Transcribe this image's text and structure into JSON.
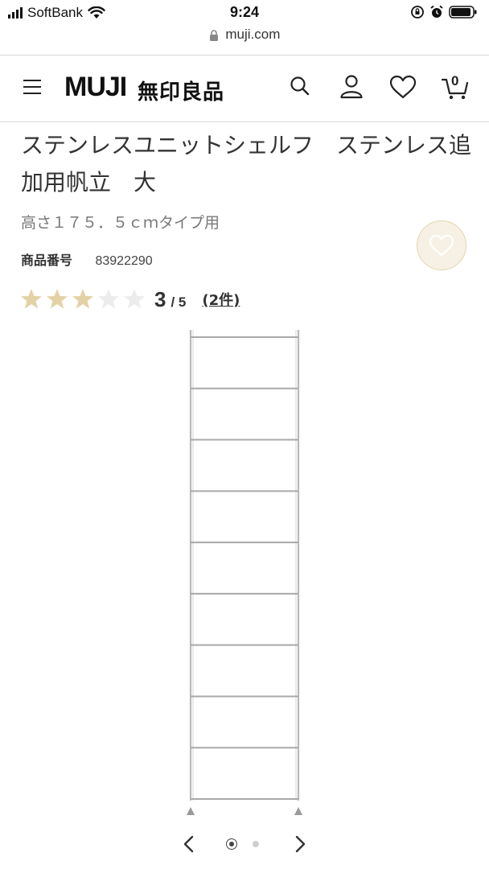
{
  "status_bar": {
    "carrier": "SoftBank",
    "time": "9:24"
  },
  "browser": {
    "url": "muji.com"
  },
  "header": {
    "logo_text": "MUJI",
    "logo_jp": "無印良品",
    "cart_count": "0",
    "icons": [
      "menu-icon",
      "search-icon",
      "account-icon",
      "favorite-icon",
      "cart-icon"
    ]
  },
  "product": {
    "title": "ステンレスユニットシェルフ　ステンレス追加用帆立　大",
    "subtitle": "高さ１７５．５ｃｍタイプ用",
    "code_label": "商品番号",
    "code_value": "83922290",
    "rating": {
      "score": "3",
      "out_of": "/ 5",
      "filled_stars": 3,
      "total_stars": 5,
      "reviews": "(2件)"
    },
    "shelf_levels": 9
  },
  "carousel": {
    "slides": 2,
    "active": 0
  },
  "colors": {
    "star_filled": "#e3d2a6",
    "star_empty": "#ececec",
    "favorite_bg": "#f6f1e4",
    "favorite_border": "#e3d4ad"
  }
}
